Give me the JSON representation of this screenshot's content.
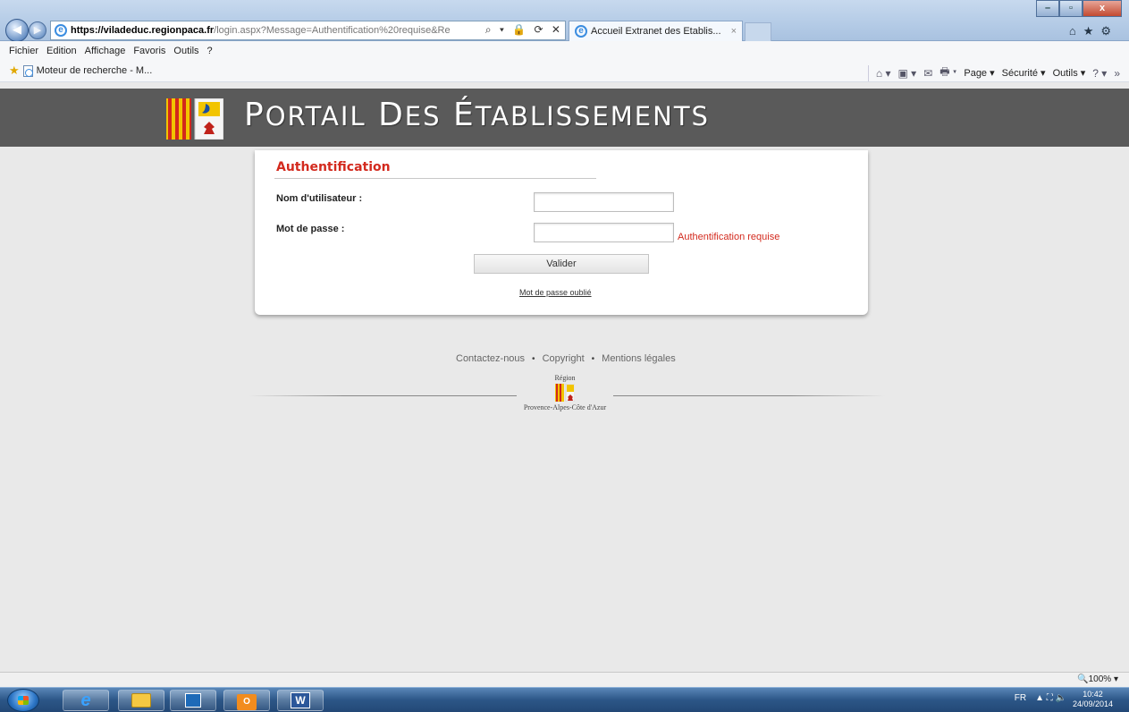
{
  "browser": {
    "url_host": "https://viladeduc.regionpaca.fr",
    "url_path": "/login.aspx?Message=Authentification%20requise&Re",
    "tab_title": "Accueil Extranet des Etablis...",
    "tab_close": "×",
    "address_tools": "⌕ ▾ 🔒 ⟳ ✕",
    "window": {
      "minimize": "–",
      "maximize": "▫",
      "close": "x"
    },
    "chrome_icons": {
      "home": "⌂",
      "favorites": "★",
      "tools": "⚙"
    },
    "menu": [
      "Fichier",
      "Edition",
      "Affichage",
      "Favoris",
      "Outils",
      "?"
    ],
    "favorites_item": "Moteur de recherche - M...",
    "command_bar": {
      "home_icon": "⌂ ▾",
      "feeds_icon": "▣ ▾",
      "mail_icon": "✉",
      "print_icon": "🖶 ▾",
      "page": "Page ▾",
      "security": "Sécurité ▾",
      "tools": "Outils ▾",
      "help": "? ▾",
      "more": "»"
    }
  },
  "banner": {
    "title": "Portail des établissements",
    "title_parts": [
      {
        "cap": "P",
        "rest": "ORTAIL"
      },
      {
        "cap": "D",
        "rest": "ES"
      },
      {
        "cap": "É",
        "rest": "TABLISSEMENTS"
      }
    ]
  },
  "login": {
    "title": "Authentification",
    "username_label": "Nom d'utilisateur :",
    "username_value": "",
    "password_label": "Mot de passe :",
    "password_value": "",
    "error": "Authentification requise",
    "submit": "Valider",
    "forgot": "Mot de passe oublié"
  },
  "footer": {
    "links": [
      "Contactez-nous",
      "Copyright",
      "Mentions légales"
    ],
    "separator": "•",
    "region_top": "Région",
    "region_bottom": "Provence-Alpes-Côte d'Azur"
  },
  "status": {
    "zoom": "🔍100% ▾"
  },
  "taskbar": {
    "ie_label": "e",
    "outlook_label": "O",
    "word_label": "W",
    "lang": "FR",
    "tray_icons": "▲ ⛶ 🔈",
    "time": "10:42",
    "date": "24/09/2014"
  },
  "colors": {
    "accent_red": "#d32a1e",
    "banner_gray": "#5a5a5a",
    "page_bg": "#e9e9e9"
  }
}
